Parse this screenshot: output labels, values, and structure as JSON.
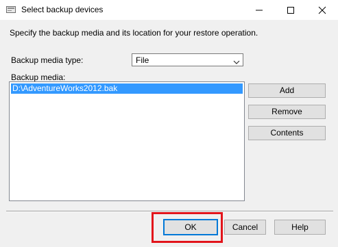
{
  "window": {
    "title": "Select backup devices",
    "icon": "window-app-icon",
    "controls": [
      "minimize-icon",
      "maximize-icon",
      "close-icon"
    ]
  },
  "description": "Specify the backup media and its location for your restore operation.",
  "media_type": {
    "label": "Backup media type:",
    "selected": "File"
  },
  "media": {
    "label": "Backup media:",
    "items": [
      "D:\\AdventureWorks2012.bak"
    ],
    "selected_index": 0
  },
  "side_buttons": {
    "add": "Add",
    "remove": "Remove",
    "contents": "Contents"
  },
  "footer_buttons": {
    "ok": "OK",
    "cancel": "Cancel",
    "help": "Help"
  },
  "colors": {
    "selection": "#3399ff",
    "highlight_box": "#e2141b",
    "default_button_border": "#0078d7"
  }
}
